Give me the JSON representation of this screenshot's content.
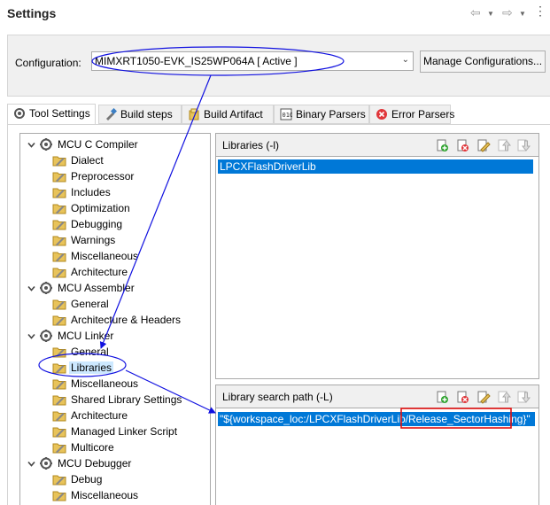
{
  "page": {
    "title": "Settings"
  },
  "config": {
    "label": "Configuration:",
    "value": "MIMXRT1050-EVK_IS25WP064A  [ Active ]",
    "manage_label": "Manage Configurations..."
  },
  "tabs": [
    {
      "label": "Tool Settings",
      "icon": "tool-settings-icon"
    },
    {
      "label": "Build steps",
      "icon": "build-steps-icon"
    },
    {
      "label": "Build Artifact",
      "icon": "build-artifact-icon"
    },
    {
      "label": "Binary Parsers",
      "icon": "binary-parsers-icon"
    },
    {
      "label": "Error Parsers",
      "icon": "error-parsers-icon"
    }
  ],
  "tree": {
    "groups": [
      {
        "label": "MCU C Compiler",
        "items": [
          "Dialect",
          "Preprocessor",
          "Includes",
          "Optimization",
          "Debugging",
          "Warnings",
          "Miscellaneous",
          "Architecture"
        ]
      },
      {
        "label": "MCU Assembler",
        "items": [
          "General",
          "Architecture & Headers"
        ]
      },
      {
        "label": "MCU Linker",
        "items": [
          "General",
          "Libraries",
          "Miscellaneous",
          "Shared Library Settings",
          "Architecture",
          "Managed Linker Script",
          "Multicore"
        ]
      },
      {
        "label": "MCU Debugger",
        "items": [
          "Debug",
          "Miscellaneous"
        ]
      }
    ],
    "selected": "Libraries"
  },
  "libraries": {
    "title": "Libraries (-l)",
    "items": [
      "LPCXFlashDriverLib"
    ]
  },
  "search_path": {
    "title": "Library search path (-L)",
    "items": [
      "\"${workspace_loc:/LPCXFlashDriverLib/Release_SectorHashing}\""
    ]
  },
  "colors": {
    "selection": "#0078d7",
    "tree_selection": "#cce8ff",
    "annotation_blue": "#1010e0",
    "annotation_red": "#e01010",
    "folder": "#e8c35a"
  }
}
